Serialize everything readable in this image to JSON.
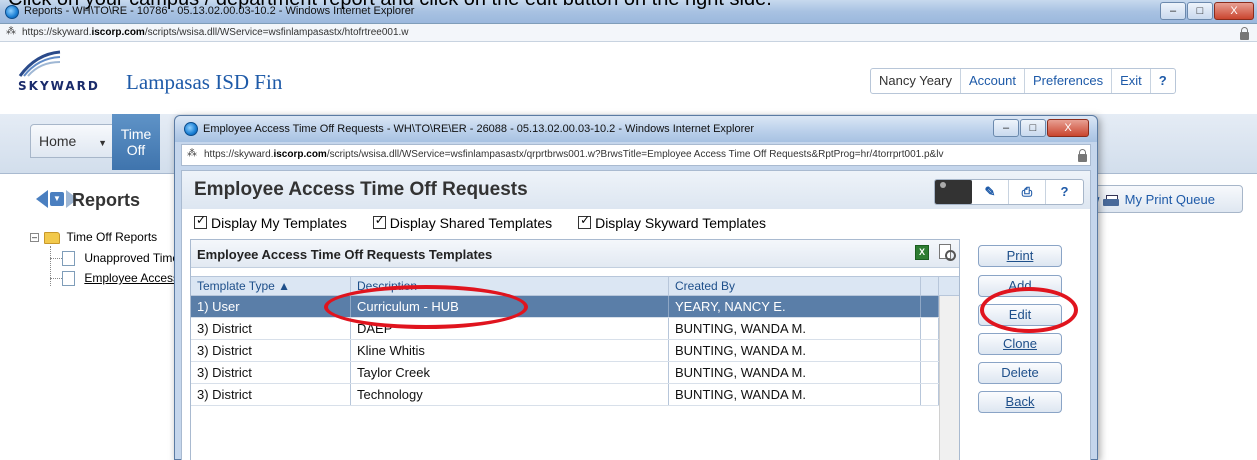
{
  "caption": "Click on your campus / department report and click on the edit button on the right side.",
  "bg_window": {
    "title": "Reports - WH\\TO\\RE - 10786 - 05.13.02.00.03-10.2 - Windows Internet Explorer",
    "url_prefix": "https://skyward.",
    "url_domain": "iscorp.com",
    "url_rest": "/scripts/wsisa.dll/WService=wsfinlampasastx/htofrtree001.w",
    "win_min": "–",
    "win_max": "□",
    "win_close": "X"
  },
  "header": {
    "logo_text": "SKYWARD",
    "district": "Lampasas ISD Fin",
    "user": "Nancy Yeary",
    "account": "Account",
    "preferences": "Preferences",
    "exit": "Exit",
    "help": "?"
  },
  "nav": {
    "home": "Home",
    "home_dd": "▼",
    "time_off_line1": "Time",
    "time_off_line2": "Off"
  },
  "reports": {
    "title": "Reports",
    "print_queue": "My Print Queue",
    "print_queue_prefix": "w",
    "tree": {
      "root": "Time Off Reports",
      "item1": "Unapproved Time Off",
      "item2": "Employee Access Time Off Requests"
    }
  },
  "popup": {
    "title": "Employee Access Time Off Requests - WH\\TO\\RE\\ER - 26088 - 05.13.02.00.03-10.2 - Windows Internet Explorer",
    "url_prefix": "https://skyward.",
    "url_domain": "iscorp.com",
    "url_rest": "/scripts/wsisa.dll/WService=wsfinlampasastx/qrprtbrws001.w?BrwsTitle=Employee Access Time Off Requests&RptProg=hr/4torrprt001.p&lv",
    "heading": "Employee Access Time Off Requests",
    "toolbar_help": "?",
    "checks": {
      "my": "Display My Templates",
      "shared": "Display Shared Templates",
      "skyward": "Display Skyward Templates"
    },
    "panel_title": "Employee Access Time Off Requests Templates",
    "excel_label": "X",
    "columns": {
      "type": "Template Type ▲",
      "description": "Description",
      "created_by": "Created By"
    },
    "rows": [
      {
        "type": "1) User",
        "description": "Curriculum - HUB",
        "created_by": "YEARY, NANCY E."
      },
      {
        "type": "3) District",
        "description": "DAEP",
        "created_by": "BUNTING, WANDA M."
      },
      {
        "type": "3) District",
        "description": "Kline Whitis",
        "created_by": "BUNTING, WANDA M."
      },
      {
        "type": "3) District",
        "description": "Taylor Creek",
        "created_by": "BUNTING, WANDA M."
      },
      {
        "type": "3) District",
        "description": "Technology",
        "created_by": "BUNTING, WANDA M."
      }
    ],
    "buttons": {
      "print": "Print",
      "add": "Add",
      "edit": "Edit",
      "clone": "Clone",
      "delete": "Delete",
      "back": "Back"
    }
  },
  "colors": {
    "accent": "#1e5aa8",
    "selected_row": "#5a7ea8",
    "annotation": "#e0141e"
  }
}
